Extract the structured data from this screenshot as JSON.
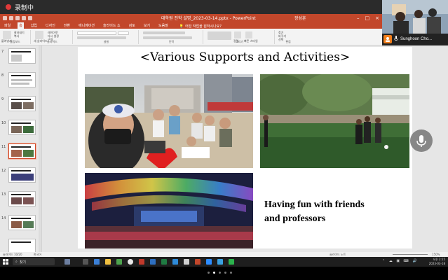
{
  "recording": {
    "label": "录制中"
  },
  "window": {
    "doc_title": "대학원 진학 설명_2023-03-14.pptx",
    "app_name": "PowerPoint",
    "title_combined": "대학원 진학 설명_2023-03-14.pptx  -  PowerPoint",
    "sign_in": "장성훈"
  },
  "ribbon_tabs": [
    "파일",
    "홈",
    "삽입",
    "디자인",
    "전환",
    "애니메이션",
    "슬라이드 쇼",
    "검토",
    "보기",
    "도움말"
  ],
  "search_hint": "어떤 작업을 원하시나요?",
  "ribbon_groups": [
    {
      "label": "클립보드",
      "buttons": [
        "붙여넣기",
        "잘라내기",
        "복사",
        "서식 복사"
      ]
    },
    {
      "label": "슬라이드",
      "buttons": [
        "새 슬라이드",
        "레이아웃",
        "다시 설정",
        "구역"
      ]
    },
    {
      "label": "글꼴",
      "buttons": []
    },
    {
      "label": "단락",
      "buttons": []
    },
    {
      "label": "그리기",
      "buttons": [
        "도형",
        "정렬",
        "빠른 스타일"
      ]
    },
    {
      "label": "편집",
      "buttons": [
        "찾기",
        "바꾸기",
        "선택"
      ]
    }
  ],
  "slide_numbers": [
    "7",
    "8",
    "9",
    "10",
    "11",
    "12",
    "13",
    "14"
  ],
  "selected_slide": "10",
  "slide": {
    "title": "<Various Supports and Activities>",
    "caption_line1": "Having fun with friends",
    "caption_line2": "and professors"
  },
  "status_bar": {
    "slide_info": "슬라이드 10/20",
    "language": "한국어",
    "notes": "슬라이드 노트",
    "zoom": "150%"
  },
  "taskbar": {
    "search_label": "찾기",
    "time": "오후 2:15",
    "date": "2023-03-18"
  },
  "webcam": {
    "name": "Sunghoon Cho..."
  },
  "presenter_page": {
    "total": 5,
    "current": 2
  },
  "colors": {
    "ppt_accent": "#c2472b",
    "record_red": "#e03a3a",
    "webcam_avatar": "#f07e1b"
  }
}
